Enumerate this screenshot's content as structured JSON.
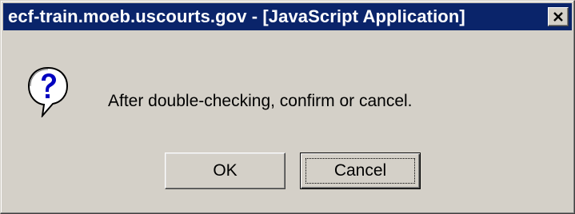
{
  "window": {
    "title": "ecf-train.moeb.uscourts.gov - [JavaScript Application]",
    "close_glyph": "✕",
    "titlebar_color": "#0a246a",
    "face_color": "#d4d0c8"
  },
  "dialog": {
    "icon": "question-icon",
    "message": "After double-checking, confirm or cancel."
  },
  "buttons": {
    "ok_label": "OK",
    "cancel_label": "Cancel",
    "focused": "Cancel"
  }
}
